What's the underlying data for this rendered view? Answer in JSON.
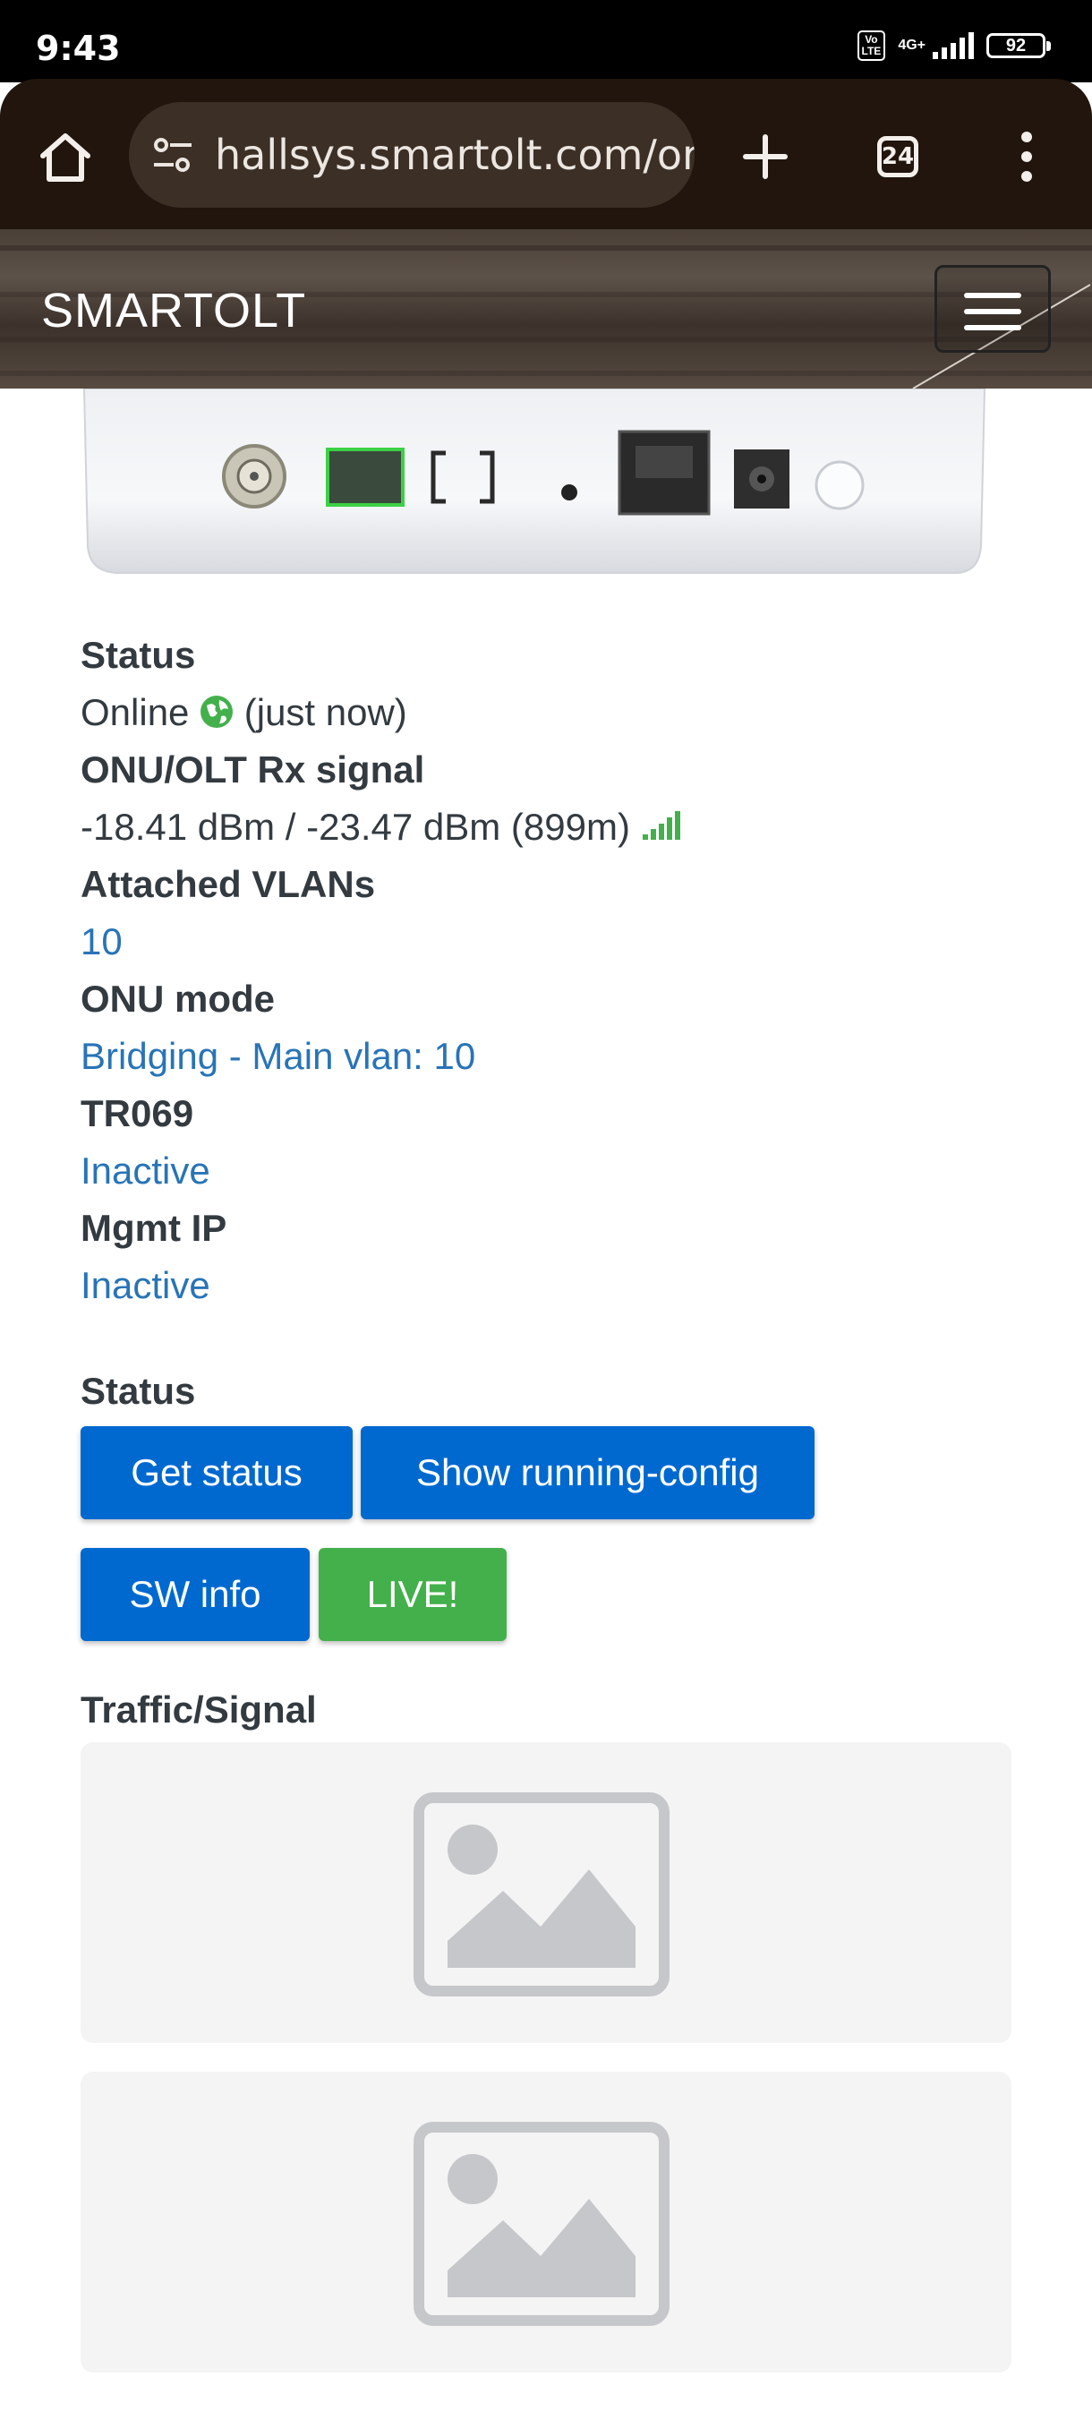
{
  "statusbar": {
    "time": "9:43",
    "volte": "Vo LTE",
    "network": "4G+",
    "battery": "92"
  },
  "browser": {
    "url": "hallsys.smartolt.com/or",
    "tab_count": "24",
    "icons": [
      "home-icon",
      "site-settings-icon",
      "new-tab-icon",
      "tab-switcher-icon",
      "menu-icon"
    ]
  },
  "site": {
    "brand": "SMARTOLT"
  },
  "onu": {
    "status_label": "Status",
    "status_value": "Online",
    "status_time": "(just now)",
    "rx_label": "ONU/OLT Rx signal",
    "rx_value": "-18.41 dBm / -23.47 dBm (899m)",
    "vlans_label": "Attached VLANs",
    "vlans_value": "10",
    "mode_label": "ONU mode",
    "mode_value": "Bridging - Main vlan: 10",
    "tr069_label": "TR069",
    "tr069_value": "Inactive",
    "mgmt_label": "Mgmt IP",
    "mgmt_value": "Inactive"
  },
  "actions": {
    "title": "Status",
    "get_status": "Get status",
    "show_config": "Show running-config",
    "sw_info": "SW info",
    "live": "LIVE!"
  },
  "traffic": {
    "title": "Traffic/Signal"
  },
  "colors": {
    "primary_button": "#0069d0",
    "live_button": "#43b04b",
    "link": "#2874b7",
    "text": "#333a40"
  }
}
